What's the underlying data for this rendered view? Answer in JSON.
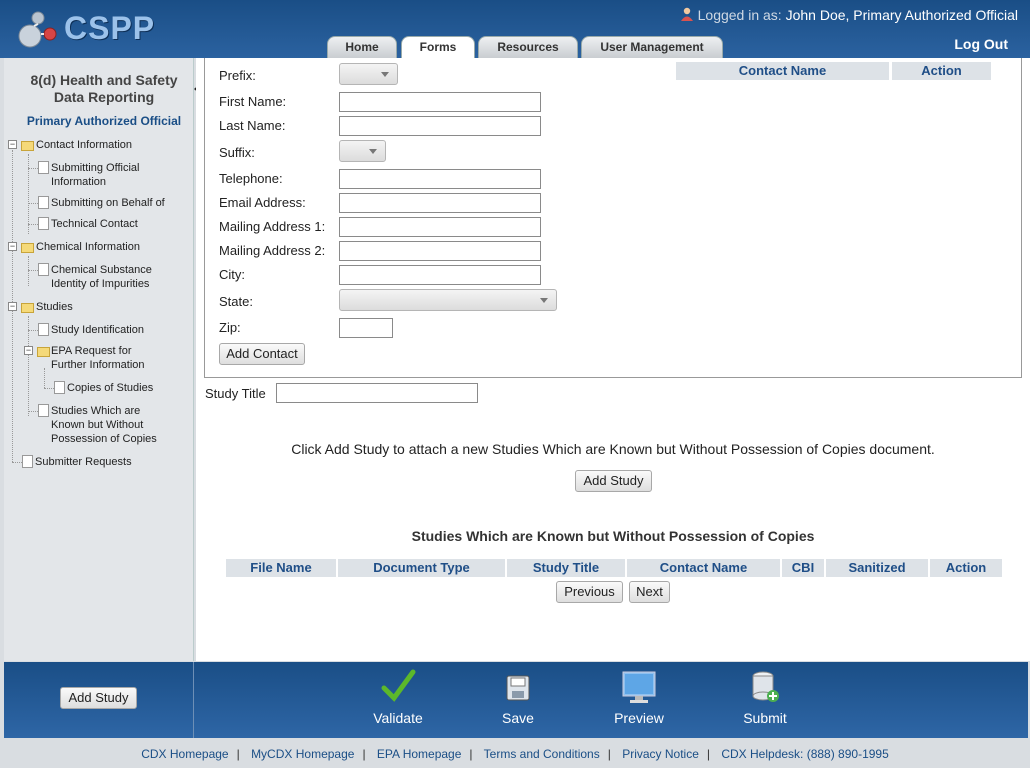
{
  "app": {
    "logo": "CSPP"
  },
  "header": {
    "logged_in_label": "Logged in as:",
    "user": "John Doe, Primary Authorized Official",
    "logout": "Log Out",
    "tabs": [
      "Home",
      "Forms",
      "Resources",
      "User Management"
    ],
    "active_tab": "Forms"
  },
  "sidebar": {
    "title_line1": "8(d) Health and Safety",
    "title_line2": "Data Reporting",
    "role": "Primary Authorized Official",
    "tree": {
      "contact_information": "Contact Information",
      "submitting_official_1": "Submitting Official",
      "submitting_official_2": "Information",
      "submitting_on_behalf": "Submitting on Behalf of",
      "technical_contact": "Technical Contact",
      "chemical_information": "Chemical Information",
      "chemical_substance_1": "Chemical Substance",
      "chemical_substance_2": "Identity of Impurities",
      "studies": "Studies",
      "study_identification": "Study Identification",
      "epa_request_1": "EPA Request for",
      "epa_request_2": "Further Information",
      "copies_of_studies": "Copies of Studies",
      "studies_known_1": "Studies Which are",
      "studies_known_2": "Known but Without",
      "studies_known_3": "Possession of Copies",
      "submitter_requests": "Submitter Requests"
    }
  },
  "form": {
    "prefix": "Prefix:",
    "first_name": "First Name:",
    "last_name": "Last Name:",
    "suffix": "Suffix:",
    "telephone": "Telephone:",
    "email": "Email Address:",
    "mailing1": "Mailing Address 1:",
    "mailing2": "Mailing Address 2:",
    "city": "City:",
    "state": "State:",
    "zip": "Zip:",
    "add_contact": "Add Contact",
    "contact_table_headers": [
      "Contact Name",
      "Action"
    ]
  },
  "study": {
    "title_label": "Study Title",
    "instruction": "Click Add Study to attach a new Studies Which are Known but Without Possession of Copies document.",
    "add_study": "Add Study",
    "table_title": "Studies Which are Known but Without Possession of Copies",
    "headers": [
      "File Name",
      "Document Type",
      "Study Title",
      "Contact Name",
      "CBI",
      "Sanitized",
      "Action"
    ],
    "previous": "Previous",
    "next": "Next"
  },
  "footer": {
    "add_study": "Add Study",
    "actions": [
      "Validate",
      "Save",
      "Preview",
      "Submit"
    ],
    "links": [
      "CDX Homepage",
      "MyCDX Homepage",
      "EPA Homepage",
      "Terms and Conditions",
      "Privacy Notice",
      "CDX Helpdesk: (888) 890-1995"
    ]
  },
  "colors": {
    "brand": "#1a4e86",
    "header_text": "#1f4e87",
    "validate_check": "#5cb82a"
  }
}
